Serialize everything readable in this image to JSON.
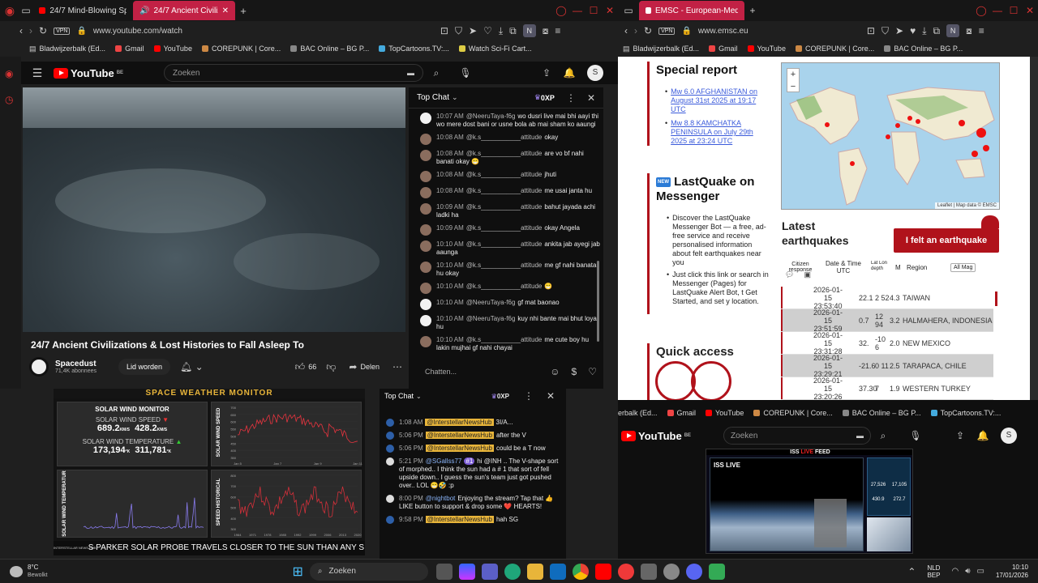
{
  "left_window": {
    "tabs": [
      "24/7 Mind-Blowing Space",
      "24/7 Ancient Civilizatio"
    ],
    "url": "www.youtube.com/watch",
    "bookmarks": [
      "Bladwijzerbalk (Ed...",
      "Gmail",
      "YouTube",
      "COREPUNK | Core...",
      "BAC Online – BG P...",
      "TopCartoons.TV:...",
      "Watch Sci-Fi Cart..."
    ],
    "search_placeholder": "Zoeken",
    "avatar_letter": "S",
    "video_title": "24/7 Ancient Civilizations & Lost Histories to Fall Asleep To",
    "channel": "Spacedust",
    "subscribers": "71,4K abonnees",
    "join_label": "Lid worden",
    "likes": "66",
    "share_label": "Delen",
    "chat": {
      "title": "Top Chat",
      "points": "0XP",
      "input_placeholder": "Chatten...",
      "messages": [
        {
          "time": "10:07 AM",
          "user": "@NeeruTaya-f6g",
          "text": "wo dusri live mai bhi aayi thi wo mere dost bani or usne bola ab mai sham ko aaungi",
          "avatar": "white"
        },
        {
          "time": "10:08 AM",
          "user": "@k.s___________attitude",
          "text": "okay",
          "avatar": "brown"
        },
        {
          "time": "10:08 AM",
          "user": "@k.s___________attitude",
          "text": "are vo bf nahi banati okay 😁",
          "avatar": "brown"
        },
        {
          "time": "10:08 AM",
          "user": "@k.s___________attitude",
          "text": "jhuti",
          "avatar": "brown"
        },
        {
          "time": "10:08 AM",
          "user": "@k.s___________attitude",
          "text": "me usai janta hu",
          "avatar": "brown"
        },
        {
          "time": "10:09 AM",
          "user": "@k.s___________attitude",
          "text": "bahut jayada achi ladki ha",
          "avatar": "brown"
        },
        {
          "time": "10:09 AM",
          "user": "@k.s___________attitude",
          "text": "okay Angela",
          "avatar": "brown"
        },
        {
          "time": "10:10 AM",
          "user": "@k.s___________attitude",
          "text": "ankita jab ayegi jab aaunga",
          "avatar": "brown"
        },
        {
          "time": "10:10 AM",
          "user": "@k.s___________attitude",
          "text": "me gf nahi banata hu okay",
          "avatar": "brown"
        },
        {
          "time": "10:10 AM",
          "user": "@k.s___________attitude",
          "text": "😁",
          "avatar": "brown"
        },
        {
          "time": "10:10 AM",
          "user": "@NeeruTaya-f6g",
          "text": "gf mat baonao",
          "avatar": "white"
        },
        {
          "time": "10:10 AM",
          "user": "@NeeruTaya-f6g",
          "text": "kuy nhi bante mai bhut loyal hu",
          "avatar": "white"
        },
        {
          "time": "10:10 AM",
          "user": "@k.s___________attitude",
          "text": "me cute boy hu lakin mujhai gf nahi chayai",
          "avatar": "brown"
        }
      ]
    }
  },
  "right_window": {
    "tab": "EMSC - European-Mediter",
    "url": "www.emsc.eu",
    "bookmarks": [
      "Bladwijzerbalk (Ed...",
      "Gmail",
      "YouTube",
      "COREPUNK | Core...",
      "BAC Online – BG P..."
    ],
    "special_report": {
      "title": "Special report",
      "links": [
        "Mw 6.0 AFGHANISTAN on August 31st 2025 at 19:17 UTC",
        "Mw 8.8 KAMCHATKA PENINSULA on July 29th 2025 at 23:24 UTC"
      ]
    },
    "lastquake": {
      "badge": "NEW",
      "title": "LastQuake on Messenger",
      "bullet1": "Discover the LastQuake Messenger Bot — a free, ad-free service and receive personalised information about felt earthquakes near you",
      "bullet2": "Just click this link or search in Messenger (Pages) for LastQuake Alert Bot, t Get Started, and set y location."
    },
    "quick_access": "Quick access",
    "map_attribution": "Leaflet | Map data © EMSC",
    "latest": {
      "title": "Latest earthquakes",
      "felt_button": "I felt an earthquake",
      "headers": [
        "Citizen response",
        "Date & Time UTC",
        "Lat Lon depth",
        "M",
        "Region"
      ],
      "filter": "All Mag",
      "rows": [
        {
          "date": "2026-01-15",
          "time": "23:53:40",
          "lat": "22.1",
          "lon": "2 52",
          "mag": "4.3",
          "region": "TAIWAN"
        },
        {
          "date": "2026-01-15",
          "time": "23:51:59",
          "lat": "0.7",
          "lon": "12 94",
          "mag": "3.2",
          "region": "HALMAHERA, INDONESIA"
        },
        {
          "date": "2026-01-15",
          "time": "23:31:28",
          "lat": "32.",
          "lon": "-10 6",
          "mag": "2.0",
          "region": "NEW MEXICO"
        },
        {
          "date": "2026-01-15",
          "time": "23:29:21",
          "lat": "-21.6",
          "lon": "0 11",
          "mag": "2.5",
          "region": "TARAPACA, CHILE"
        },
        {
          "date": "2026-01-15",
          "time": "23:20:26",
          "lat": "37.30",
          "lon": "7",
          "mag": "1.9",
          "region": "WESTERN TURKEY"
        }
      ]
    }
  },
  "bottom_left": {
    "header": "SPACE WEATHER MONITOR",
    "monitor_title": "SOLAR WIND MONITOR",
    "speed_label": "SOLAR WIND SPEED",
    "speed1": "689.2",
    "speed2": "428.2",
    "speed_unit": "KM/S",
    "temp_label": "SOLAR WIND TEMPERATURE",
    "temp1": "173,194",
    "temp2": "311,781",
    "temp_unit": "°K",
    "chart1_label": "SOLAR WIND SPEED",
    "chart2_label": "SOLAR WIND TEMPERATURE",
    "chart3_label": "SPEED HISTORICAL",
    "chart1_yticks": [
      "700",
      "650",
      "600",
      "550",
      "500",
      "450",
      "400",
      "350"
    ],
    "chart1_xticks": [
      "Jan 5",
      "Jan 7",
      "Jan 9",
      "Jan 11"
    ],
    "chart3_yticks": [
      "800",
      "700",
      "600",
      "500",
      "400",
      "300"
    ],
    "chart3_xticks": [
      "1964",
      "1971",
      "1978",
      "1985",
      "1992",
      "1999",
      "2006",
      "2013",
      "2020"
    ],
    "ticker": "S PARKER SOLAR PROBE TRAVELS CLOSER TO THE SUN THAN ANY S",
    "logo_text": "INTERSTELLAR NEWS HUB"
  },
  "bottom_chat": {
    "title": "Top Chat",
    "points": "0XP",
    "messages": [
      {
        "time": "1:08 AM",
        "user": "@InterstellarNewsHub",
        "text": "3I/A..."
      },
      {
        "time": "5:06 PM",
        "user": "@InterstellarNewsHub",
        "text": "after the V"
      },
      {
        "time": "5:06 PM",
        "user": "@InterstellarNewsHub",
        "text": "could be a T now"
      },
      {
        "time": "5:21 PM",
        "user": "@SGallss77",
        "text": "hi @INH .. The V-shape sort of morphed.. I think the sun had a # 1 that sort of fell upside down.. I guess the sun's team just got pushed over.. LOL 😁🤣 :p",
        "badge": "#1"
      },
      {
        "time": "8:00 PM",
        "user": "@nightbot",
        "text": "Enjoying the stream? Tap that 👍 LIKE button to support & drop some ❤️ HEARTS!"
      },
      {
        "time": "9:58 PM",
        "user": "@InterstellarNewsHub",
        "text": "hah SG"
      }
    ]
  },
  "bottom_right": {
    "bookmarks": [
      "erbalk (Ed...",
      "Gmail",
      "YouTube",
      "COREPUNK | Core...",
      "BAC Online – BG P...",
      "TopCartoons.TV:..."
    ],
    "search_placeholder": "Zoeken",
    "avatar_letter": "S",
    "feed_title_a": "ISS ",
    "feed_title_live": "LIVE",
    "feed_title_b": " FEED",
    "iss_live": "ISS LIVE",
    "stats": [
      "27,526",
      "17,105",
      "430.9",
      "272.7"
    ]
  },
  "taskbar": {
    "temp": "8°C",
    "weather": "Bewolkt",
    "search": "Zoeken",
    "lang1": "NLD",
    "lang2": "BEP",
    "time": "10:10",
    "date": "17/01/2026"
  }
}
